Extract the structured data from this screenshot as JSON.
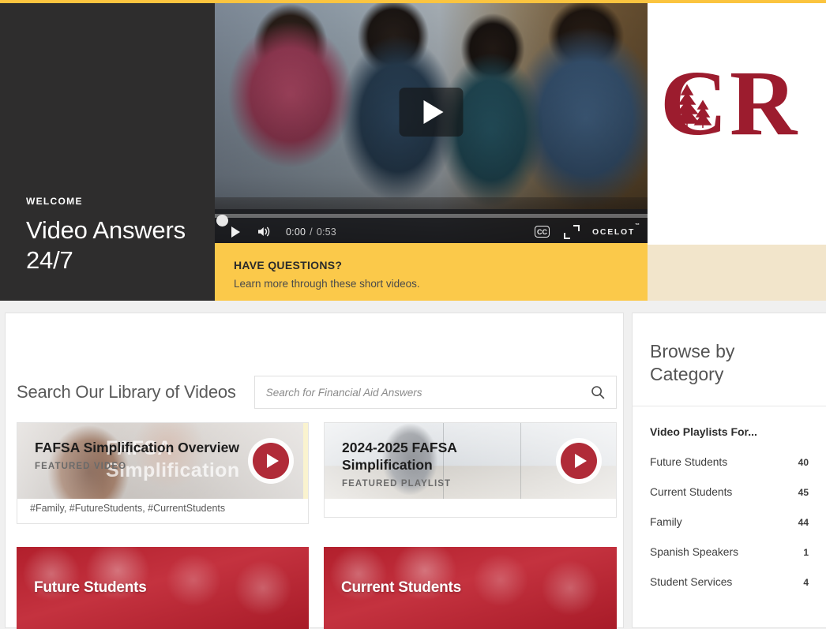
{
  "hero": {
    "kicker": "WELCOME",
    "title_line1": "Video Answers",
    "title_line2": "24/7",
    "callout_title": "HAVE QUESTIONS?",
    "callout_sub": "Learn more through these short videos.",
    "logo_alt": "CR"
  },
  "player": {
    "current_time": "0:00",
    "separator": "/",
    "duration": "0:53",
    "cc_label": "CC",
    "brand": "ocelot",
    "brand_tm": "™"
  },
  "search": {
    "heading": "Search Our Library of Videos",
    "placeholder": "Search for Financial Aid Answers",
    "value": ""
  },
  "featured": [
    {
      "title": "FAFSA Simplification Overview",
      "kicker": "FEATURED VIDEO",
      "ghost_line1": "FAFSA",
      "ghost_line2": "Simplification",
      "tags": "#Family, #FutureStudents, #CurrentStudents"
    },
    {
      "title_line1": "2024-2025 FAFSA",
      "title_line2": "Simplification",
      "kicker": "FEATURED PLAYLIST"
    }
  ],
  "tiles": [
    {
      "label": "Future Students"
    },
    {
      "label": "Current Students"
    }
  ],
  "sidebar": {
    "title_line1": "Browse by",
    "title_line2": "Category",
    "section_label": "Video Playlists For...",
    "categories": [
      {
        "name": "Future Students",
        "count": "40"
      },
      {
        "name": "Current Students",
        "count": "45"
      },
      {
        "name": "Family",
        "count": "44"
      },
      {
        "name": "Spanish Speakers",
        "count": "1"
      },
      {
        "name": "Student Services",
        "count": "4"
      }
    ]
  },
  "colors": {
    "gold": "#fbc94a",
    "dark": "#2e2d2d",
    "cream": "#f2e5cb",
    "brand_red": "#b02b38",
    "tile_red": "#b21f2c"
  }
}
